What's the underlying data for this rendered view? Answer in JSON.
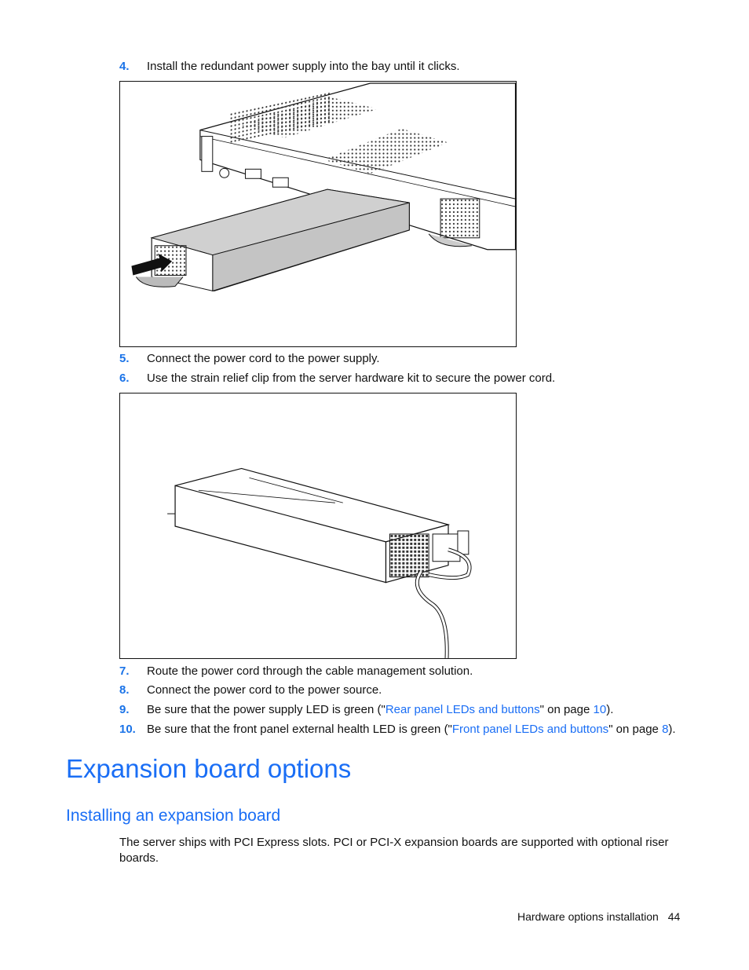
{
  "steps_top": [
    {
      "num": "4.",
      "text": "Install the redundant power supply into the bay until it clicks."
    }
  ],
  "figure1": {
    "alt": "Redundant power supply being inserted into server power supply bay (arrow indicates direction)"
  },
  "steps_mid": [
    {
      "num": "5.",
      "text": "Connect the power cord to the power supply."
    },
    {
      "num": "6.",
      "text": "Use the strain relief clip from the server hardware kit to secure the power cord."
    }
  ],
  "figure2": {
    "alt": "Power supply with power cord secured by strain relief clip"
  },
  "steps_bottom": [
    {
      "num": "7.",
      "text": "Route the power cord through the cable management solution."
    },
    {
      "num": "8.",
      "text": "Connect the power cord to the power source."
    },
    {
      "num": "9.",
      "pre": "Be sure that the power supply LED is green (\"",
      "link": "Rear panel LEDs and buttons",
      "mid": "\" on page ",
      "page": "10",
      "post": ")."
    },
    {
      "num": "10.",
      "pre": "Be sure that the front panel external health LED is green (\"",
      "link": "Front panel LEDs and buttons",
      "mid": "\" on page ",
      "page": "8",
      "post": ")."
    }
  ],
  "section": {
    "title": "Expansion board options",
    "subtitle": "Installing an expansion board",
    "body": "The server ships with PCI Express slots. PCI or PCI-X expansion boards are supported with optional riser boards."
  },
  "footer": {
    "chapter": "Hardware options installation",
    "page": "44"
  },
  "colors": {
    "accent": "#1a6ef5",
    "number": "#1a73e8"
  }
}
